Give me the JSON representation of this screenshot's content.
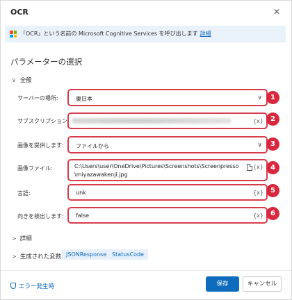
{
  "dialog": {
    "title": "OCR",
    "close_glyph": "✕"
  },
  "info": {
    "text": "「OCR」という名前の Microsoft Cognitive Services を呼び出します",
    "link": "詳細",
    "logo": "microsoft-logo"
  },
  "section_title": "パラメーターの選択",
  "group": {
    "chevron": "∨",
    "label": "全般"
  },
  "fields": {
    "server": {
      "label": "サーバーの場所:",
      "value": "東日本",
      "badge": "1",
      "arrow": "∨"
    },
    "subscription": {
      "label": "サブスクリプション キー:",
      "suffix": "{x}",
      "badge": "2"
    },
    "image_source": {
      "label": "画像を提供します:",
      "value": "ファイルから",
      "badge": "3",
      "arrow": "∨"
    },
    "image_file": {
      "label": "画像ファイル:",
      "value_line1": "C:\\Users\\user\\OneDrive\\Pictures\\Screenshots\\Screenpresso",
      "value_line2": "\\miyazawakenji.jpg",
      "suffix": "{x}",
      "badge": "4"
    },
    "language": {
      "label": "言語:",
      "value": "unk",
      "suffix": "{x}",
      "badge": "5"
    },
    "orientation": {
      "label": "向きを検出します:",
      "value": "false",
      "suffix": "{x}",
      "badge": "6"
    }
  },
  "details": {
    "chevron": ">",
    "label": "詳細"
  },
  "variables": {
    "chevron": ">",
    "label": "生成された変数",
    "chips": [
      "JSONResponse",
      "StatusCode"
    ]
  },
  "footer": {
    "error_link": "エラー発生時",
    "save": "保存",
    "cancel": "キャンセル"
  },
  "colors": {
    "accent": "#0f6cbd",
    "highlight_border": "#d83b4b",
    "badge": "#d8283f",
    "info_bg": "#e9f1fb"
  }
}
